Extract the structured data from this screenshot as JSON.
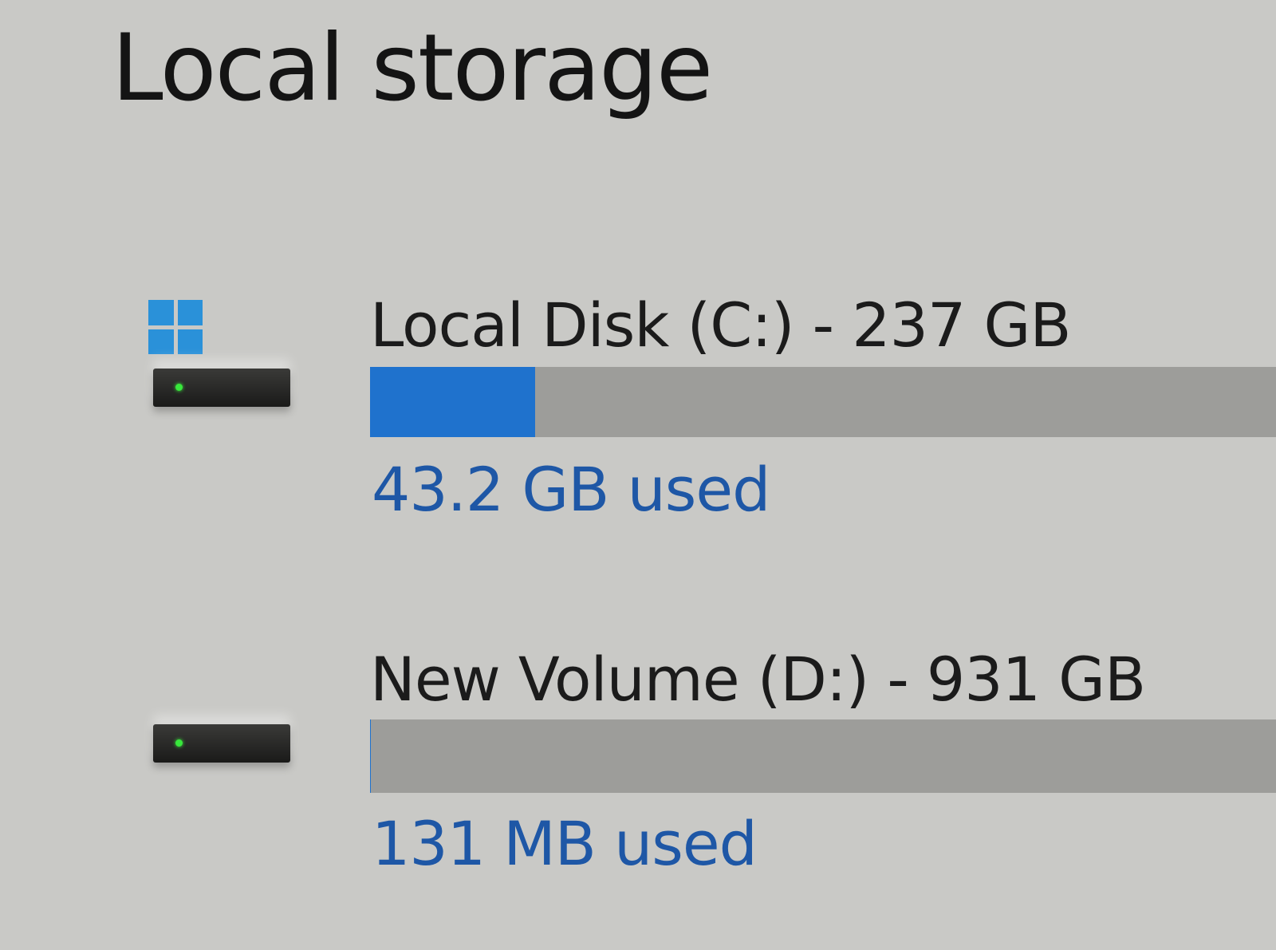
{
  "page": {
    "title": "Local storage"
  },
  "drives": [
    {
      "name": "Local Disk (C:) - 237 GB",
      "used_text": "43.2 GB used",
      "used_fraction": 0.182,
      "system_drive": true,
      "icons": [
        "windows-logo-icon",
        "hard-drive-icon"
      ]
    },
    {
      "name": "New Volume (D:) - 931 GB",
      "used_text": "131 MB used",
      "used_fraction": 0.0001,
      "system_drive": false,
      "icons": [
        "hard-drive-icon"
      ]
    }
  ],
  "colors": {
    "background": "#c9c9c6",
    "bar_track": "#9d9d9a",
    "bar_fill": "#1f72cd",
    "used_text": "#1e57a6",
    "windows_logo": "#2a91d9",
    "drive_led": "#38e83c"
  }
}
